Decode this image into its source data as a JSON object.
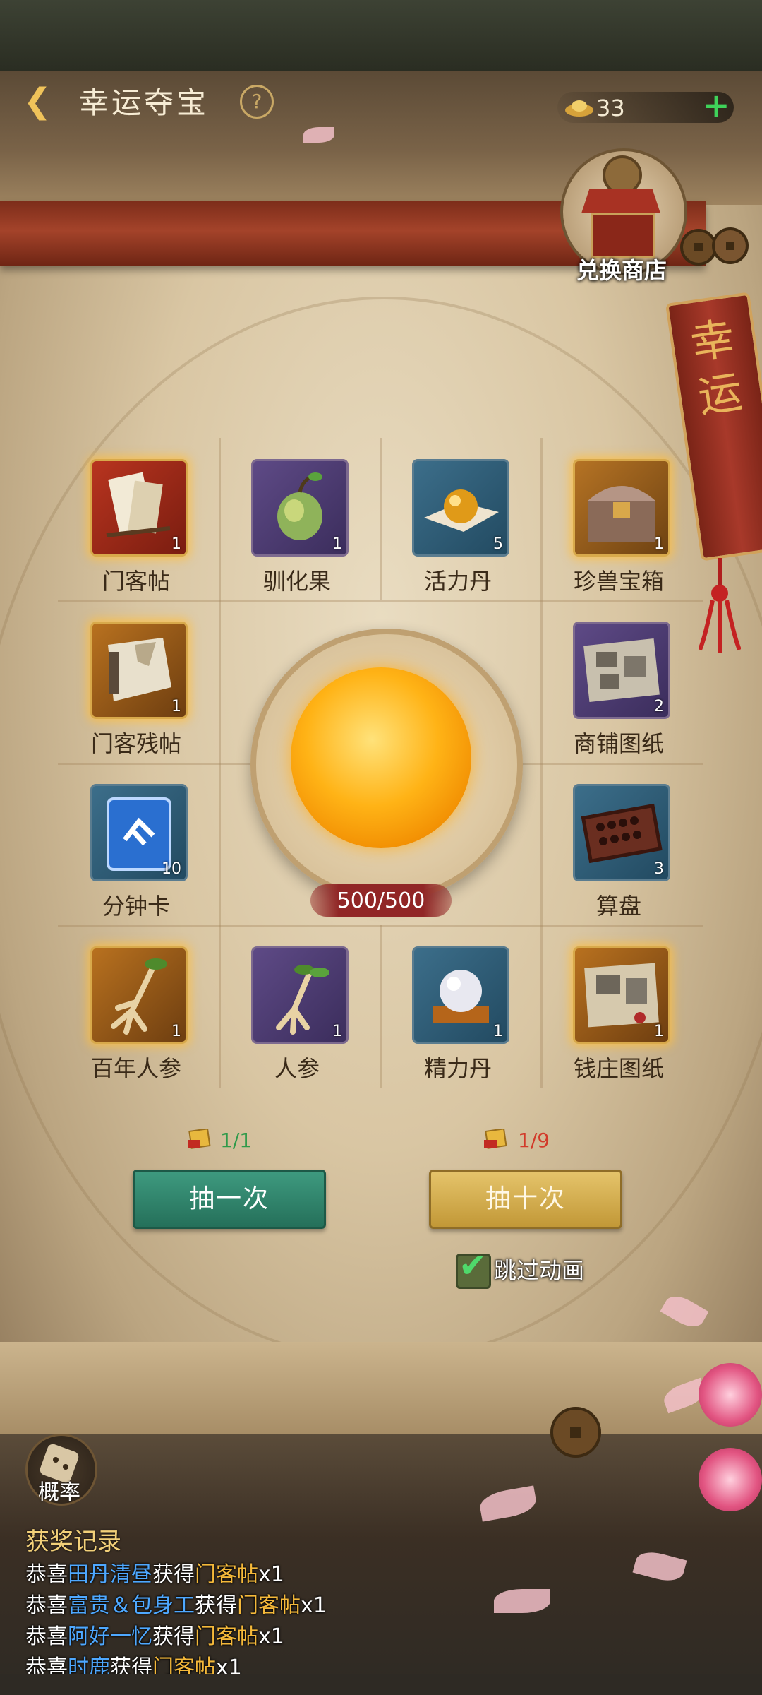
{
  "header": {
    "title": "幸运夺宝",
    "currency_value": "33"
  },
  "shop": {
    "label": "兑换商店",
    "plaque_text": "幸运"
  },
  "prize_grid": {
    "items": [
      {
        "name": "门客帖",
        "count": "1",
        "icon": "scroll-book-icon",
        "rarity": "gold"
      },
      {
        "name": "驯化果",
        "count": "1",
        "icon": "sprout-fruit-icon",
        "rarity": "purple"
      },
      {
        "name": "活力丹",
        "count": "5",
        "icon": "golden-pill-icon",
        "rarity": "blue"
      },
      {
        "name": "珍兽宝箱",
        "count": "1",
        "icon": "treasure-chest-icon",
        "rarity": "gold"
      },
      {
        "name": "门客残帖",
        "count": "1",
        "icon": "torn-scroll-icon",
        "rarity": "gold"
      },
      {
        "name": "商铺图纸",
        "count": "2",
        "icon": "blueprint-icon",
        "rarity": "purple"
      },
      {
        "name": "分钟卡",
        "count": "10",
        "icon": "minute-card-icon",
        "rarity": "blue"
      },
      {
        "name": "算盘",
        "count": "3",
        "icon": "abacus-icon",
        "rarity": "blue"
      },
      {
        "name": "百年人参",
        "count": "1",
        "icon": "old-ginseng-icon",
        "rarity": "gold"
      },
      {
        "name": "人参",
        "count": "1",
        "icon": "ginseng-icon",
        "rarity": "purple"
      },
      {
        "name": "精力丹",
        "count": "1",
        "icon": "pearl-pill-icon",
        "rarity": "blue"
      },
      {
        "name": "钱庄图纸",
        "count": "1",
        "icon": "bank-blueprint-icon",
        "rarity": "gold"
      }
    ]
  },
  "orb": {
    "progress_text": "500/500",
    "progress_fraction": 1.0
  },
  "draw": {
    "single": {
      "cost": "1/1",
      "label": "抽一次",
      "cost_color": "#2f9a4a"
    },
    "ten": {
      "cost": "1/9",
      "label": "抽十次",
      "cost_color": "#d23a2a"
    },
    "skip_label": "跳过动画",
    "skip_checked": true
  },
  "bottom": {
    "prob_label": "概率",
    "records_title": "获奖记录",
    "records": [
      {
        "prefix": "恭喜",
        "player": "田丹清昼",
        "mid": "获得",
        "item": "门客帖",
        "qty": "x1"
      },
      {
        "prefix": "恭喜",
        "player": "富贵＆包身工",
        "mid": "获得",
        "item": "门客帖",
        "qty": "x1"
      },
      {
        "prefix": "恭喜",
        "player": "阿好一忆",
        "mid": "获得",
        "item": "门客帖",
        "qty": "x1"
      },
      {
        "prefix": "恭喜",
        "player": "时鹿",
        "mid": "获得",
        "item": "门客帖",
        "qty": "x1"
      }
    ]
  },
  "colors": {
    "accent_gold": "#f0c35a",
    "player_blue": "#4ea8ff",
    "item_gold": "#f5b93a",
    "plus_green": "#3fd25a"
  }
}
